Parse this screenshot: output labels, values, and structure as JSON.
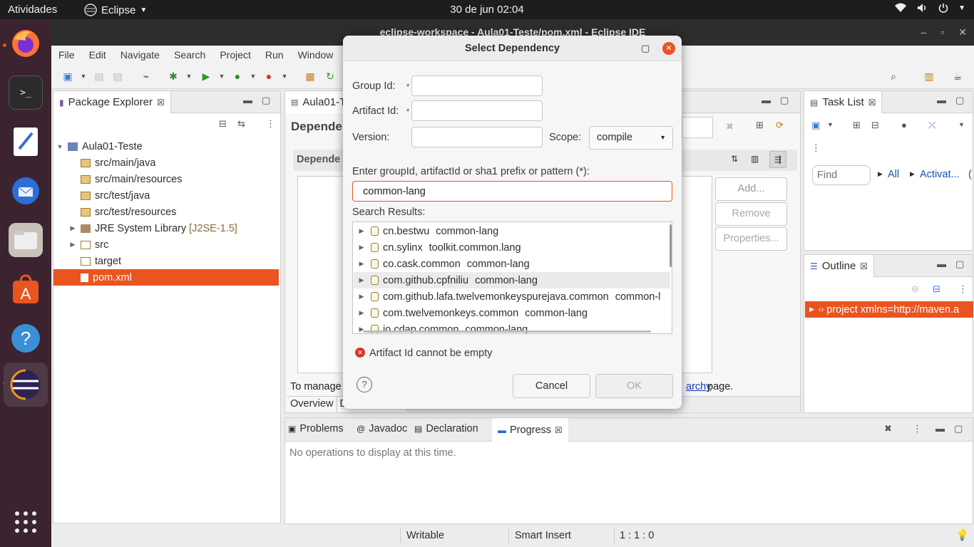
{
  "topbar": {
    "activities": "Atividades",
    "app_name": "Eclipse",
    "clock": "30 de jun  02:04"
  },
  "eclipse": {
    "title": "eclipse-workspace - Aula01-Teste/pom.xml - Eclipse IDE",
    "menu": [
      "File",
      "Edit",
      "Navigate",
      "Search",
      "Project",
      "Run",
      "Window",
      "H"
    ]
  },
  "package_explorer": {
    "tab": "Package Explorer",
    "items": [
      {
        "label": "Aula01-Teste",
        "suffix": ""
      },
      {
        "label": "src/main/java",
        "suffix": ""
      },
      {
        "label": "src/main/resources",
        "suffix": ""
      },
      {
        "label": "src/test/java",
        "suffix": ""
      },
      {
        "label": "src/test/resources",
        "suffix": ""
      },
      {
        "label": "JRE System Library",
        "suffix": "[J2SE-1.5]"
      },
      {
        "label": "src",
        "suffix": ""
      },
      {
        "label": "target",
        "suffix": ""
      },
      {
        "label": "pom.xml",
        "suffix": ""
      }
    ]
  },
  "editor": {
    "tab": "Aula01-T",
    "header": "Depende",
    "section": "Depende",
    "buttons": {
      "add": "Add...",
      "remove": "Remove",
      "properties": "Properties..."
    },
    "footer_text": "To manage",
    "footer_link": "archy",
    "footer_end": "page.",
    "bottom_tabs": [
      "Overview",
      "D"
    ]
  },
  "task_list": {
    "tab": "Task List",
    "find_placeholder": "Find",
    "all": "All",
    "activate": "Activat...",
    "paren": "("
  },
  "outline": {
    "tab": "Outline",
    "item": "project xmlns=http://maven.a"
  },
  "bottom_panel": {
    "tabs": [
      "Problems",
      "Javadoc",
      "Declaration",
      "Progress"
    ],
    "message": "No operations to display at this time."
  },
  "status_bar": {
    "writable": "Writable",
    "insert": "Smart Insert",
    "position": "1 : 1 : 0"
  },
  "dialog": {
    "title": "Select Dependency",
    "group_label": "Group Id:",
    "artifact_label": "Artifact Id:",
    "version_label": "Version:",
    "scope_label": "Scope:",
    "scope_value": "compile",
    "required_mark": "*",
    "search_label": "Enter groupId, artifactId or sha1 prefix or pattern (*):",
    "search_value": "common-lang",
    "results_label": "Search Results:",
    "results": [
      {
        "group": "cn.bestwu",
        "artifact": "common-lang"
      },
      {
        "group": "cn.sylinx",
        "artifact": "toolkit.common.lang"
      },
      {
        "group": "co.cask.common",
        "artifact": "common-lang"
      },
      {
        "group": "com.github.cpfniliu",
        "artifact": "common-lang"
      },
      {
        "group": "com.github.lafa.twelvemonkeyspurejava.common",
        "artifact": "common-l"
      },
      {
        "group": "com.twelvemonkeys.common",
        "artifact": "common-lang"
      },
      {
        "group": "io.cdap.common",
        "artifact": "common-lang"
      }
    ],
    "error": "Artifact Id cannot be empty",
    "cancel": "Cancel",
    "ok": "OK",
    "help": "?"
  },
  "colors": {
    "accent": "#e95420",
    "dock": "#3b2330",
    "topbar": "#1d1d1d",
    "error": "#d9362b"
  }
}
